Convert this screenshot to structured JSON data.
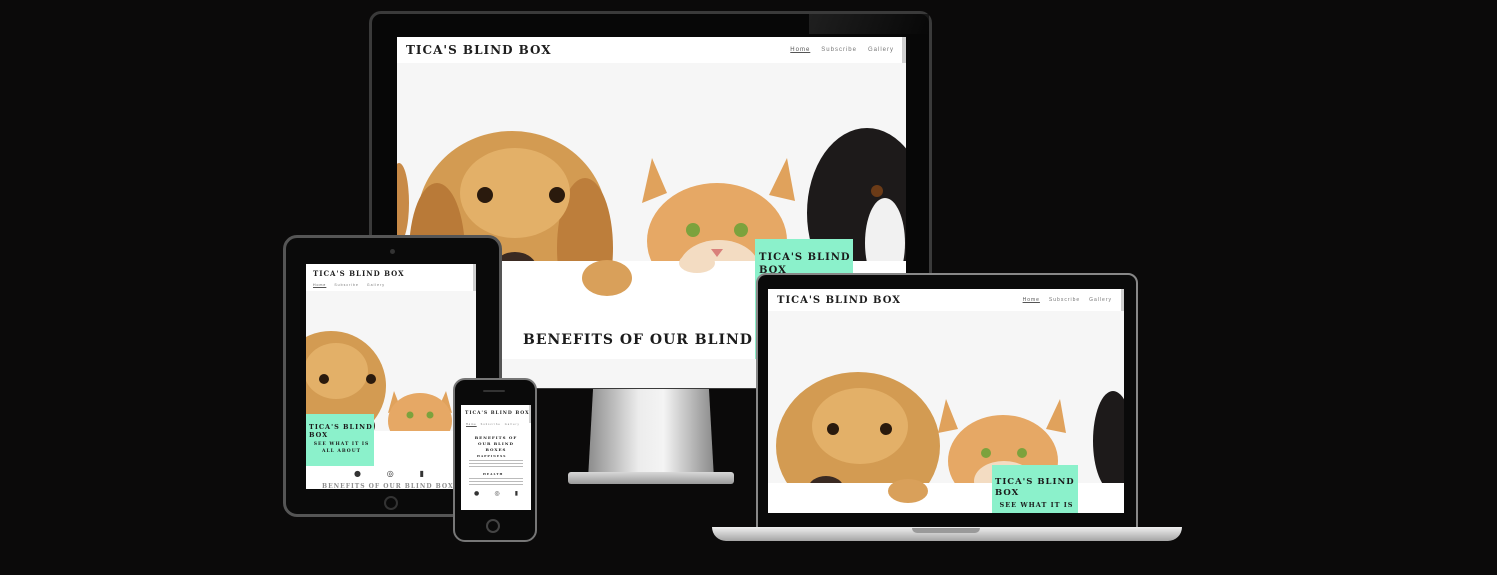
{
  "site": {
    "brand": "TICA'S BLIND BOX",
    "nav": [
      "Home",
      "Subscribe",
      "Gallery"
    ],
    "hero_title_line1": "TICA'S BLIND",
    "hero_title_line2": "BOX",
    "hero_title_full": "TICA'S BLIND BOX",
    "hero_sub_line1": "SEE WHAT IT IS",
    "hero_sub_line2": "ALL ABOUT",
    "benefits_heading": "BENEFITS OF OUR BLIND BOX",
    "benefits_heading_mobile": "BENEFITS OF OUR BLIND BOXES",
    "section_happiness": "HAPPINESS",
    "section_health": "HEALTH"
  },
  "colors": {
    "background": "#0b0a0a",
    "accent_mint": "#8bf1cb",
    "nav_text": "#777777",
    "device_silver": "#c9c9c9"
  },
  "icons": [
    "facebook-icon",
    "instagram-icon",
    "discord-icon",
    "heart-icon",
    "paw-icon"
  ]
}
